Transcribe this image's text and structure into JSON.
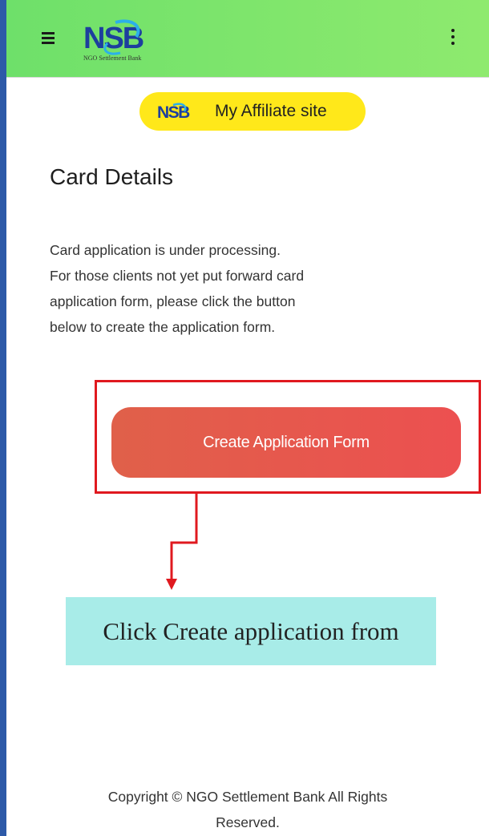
{
  "header": {
    "menu_icon": "hamburger-menu-icon",
    "logo_text": "NSB",
    "logo_subtitle": "NGO Settlement Bank",
    "more_icon": "kebab-menu-icon",
    "background": "#7ee56c"
  },
  "affiliate": {
    "logo_text": "NSB",
    "label": "My Affiliate site",
    "color": "#ffe81a"
  },
  "main": {
    "title": "Card Details",
    "description_lines": [
      "Card application is under processing.",
      "For those clients not yet put forward card",
      "application form, please click the button",
      "below to create the application form."
    ],
    "create_button_label": "Create Application Form",
    "button_color": "#e8574c"
  },
  "annotation": {
    "callout_text": "Click Create application from",
    "box_color": "#e0191f",
    "callout_color": "#a8ece8"
  },
  "footer": {
    "line1": "Copyright © NGO Settlement Bank All Rights",
    "line2": "Reserved."
  }
}
